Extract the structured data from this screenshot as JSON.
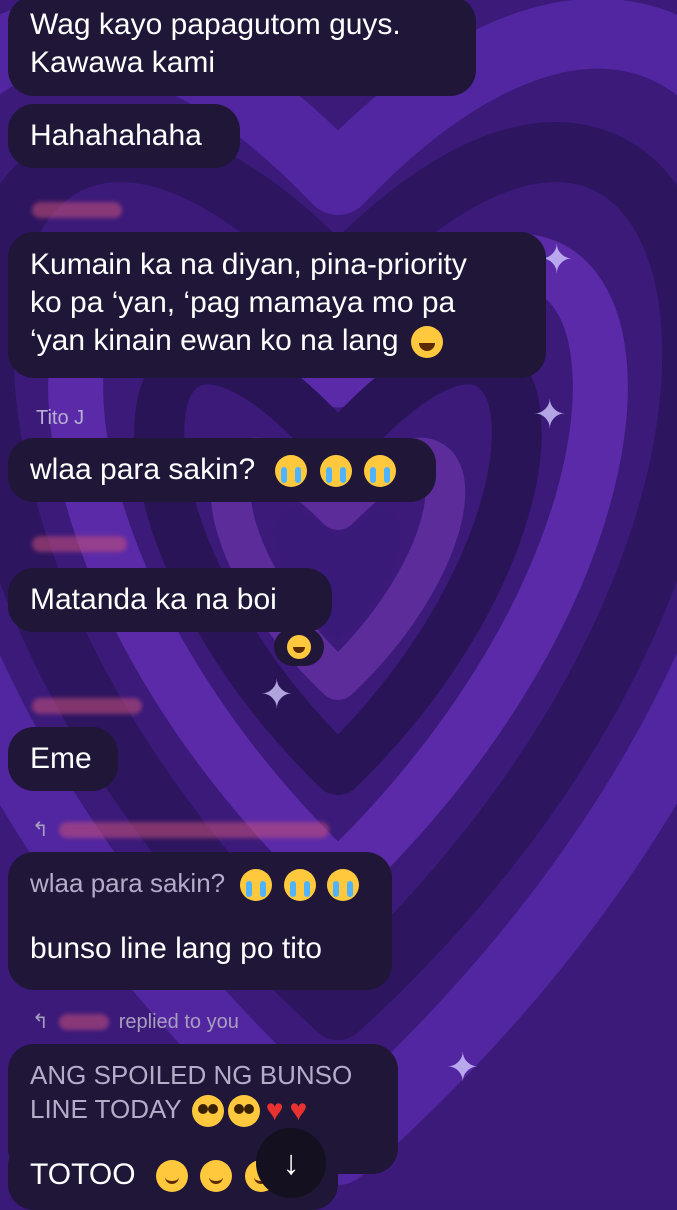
{
  "messages": [
    {
      "id": "m1",
      "lines": [
        "Wag kayo papagutom guys.",
        "Kawawa kami"
      ]
    },
    {
      "id": "m2",
      "text": "Hahahahaha"
    },
    {
      "id": "m3",
      "lines": [
        "Kumain ka na diyan, pina-priority",
        "ko pa ‘yan, ‘pag mamaya mo pa",
        "‘yan kinain ewan ko na lang"
      ],
      "emoji": "face-with-tears-of-joy"
    },
    {
      "id": "m4",
      "sender": "Tito J",
      "text": "wlaa para sakin?",
      "emojis": [
        "loudly-crying-face",
        "loudly-crying-face",
        "loudly-crying-face"
      ]
    },
    {
      "id": "m5",
      "text": "Matanda ka na boi",
      "reaction": "grinning-squinting-face"
    },
    {
      "id": "m6",
      "text": "Eme"
    },
    {
      "id": "m7",
      "quote": "wlaa para sakin?",
      "quote_emojis": [
        "loudly-crying-face",
        "loudly-crying-face",
        "loudly-crying-face"
      ],
      "text": "bunso line lang po tito"
    },
    {
      "id": "m8",
      "reply_label": "replied to you",
      "quote_lines": [
        "ANG SPOILED NG BUNSO",
        "LINE TODAY"
      ],
      "quote_emojis": [
        "pleading-face",
        "pleading-face",
        "red-heart",
        "red-heart"
      ]
    },
    {
      "id": "m9",
      "text": "TOTOO",
      "emojis": [
        "smiling-face",
        "smiling-face",
        "smiling-face"
      ]
    }
  ],
  "scroll_button": {
    "icon": "arrow-down-icon",
    "glyph": "↓"
  },
  "theme": {
    "bubble": "#1f1638",
    "background": "#3a1a78",
    "accent": "#6a3bc8"
  }
}
